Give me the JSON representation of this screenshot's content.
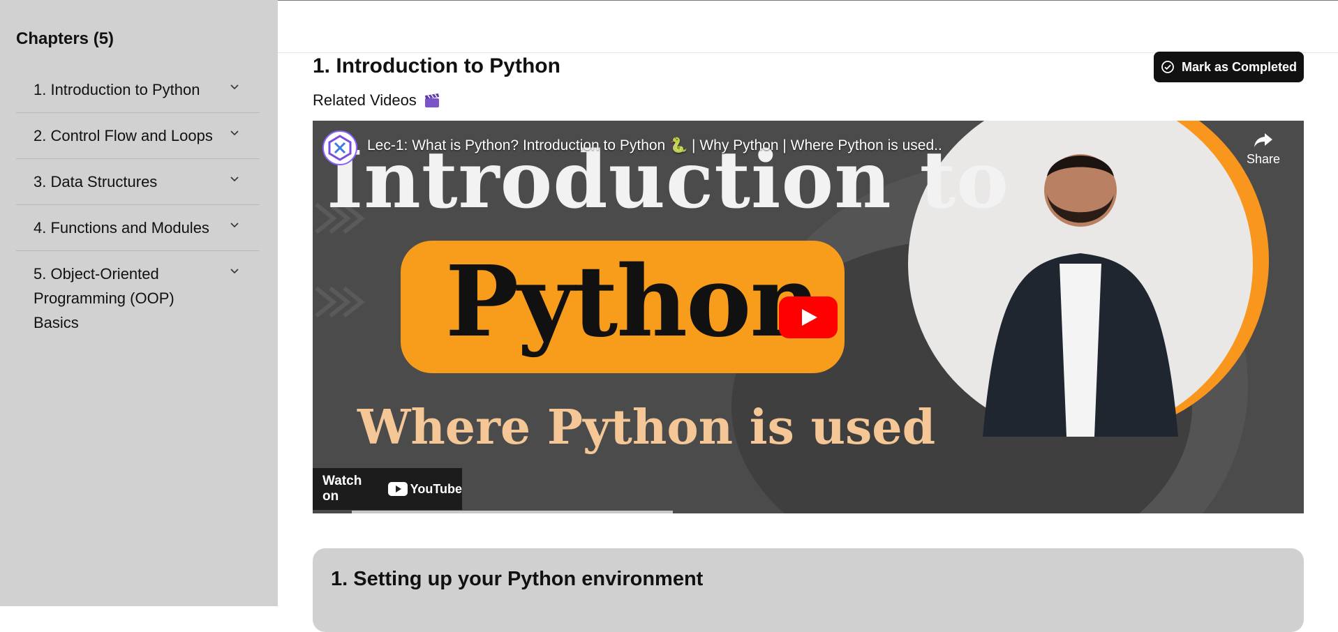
{
  "sidebar": {
    "title": "Chapters (5)",
    "chapters": [
      {
        "label": "1. Introduction to Python"
      },
      {
        "label": "2. Control Flow and Loops"
      },
      {
        "label": "3. Data Structures"
      },
      {
        "label": "4. Functions and Modules"
      },
      {
        "label": "5. Object-Oriented Programming (OOP) Basics"
      }
    ]
  },
  "main": {
    "title": "1. Introduction to Python",
    "complete_button": "Mark as Completed",
    "related_label": "Related Videos",
    "related_icon": "clapperboard-icon"
  },
  "video": {
    "title": "Lec-1: What is Python? Introduction to Python 🐍 | Why Python | Where Python is used..",
    "share_label": "Share",
    "thumbnail_line1": "Introduction to",
    "thumbnail_line2": "Python",
    "thumbnail_line3": "Where Python is used",
    "watch_on": "Watch on",
    "platform": "YouTube"
  },
  "section": {
    "title": "1. Setting up your Python environment"
  },
  "colors": {
    "sidebar_bg": "#d1d1d1",
    "button_bg": "#111111",
    "play_red": "#ff0000",
    "pill_orange": "#f89c1c"
  }
}
